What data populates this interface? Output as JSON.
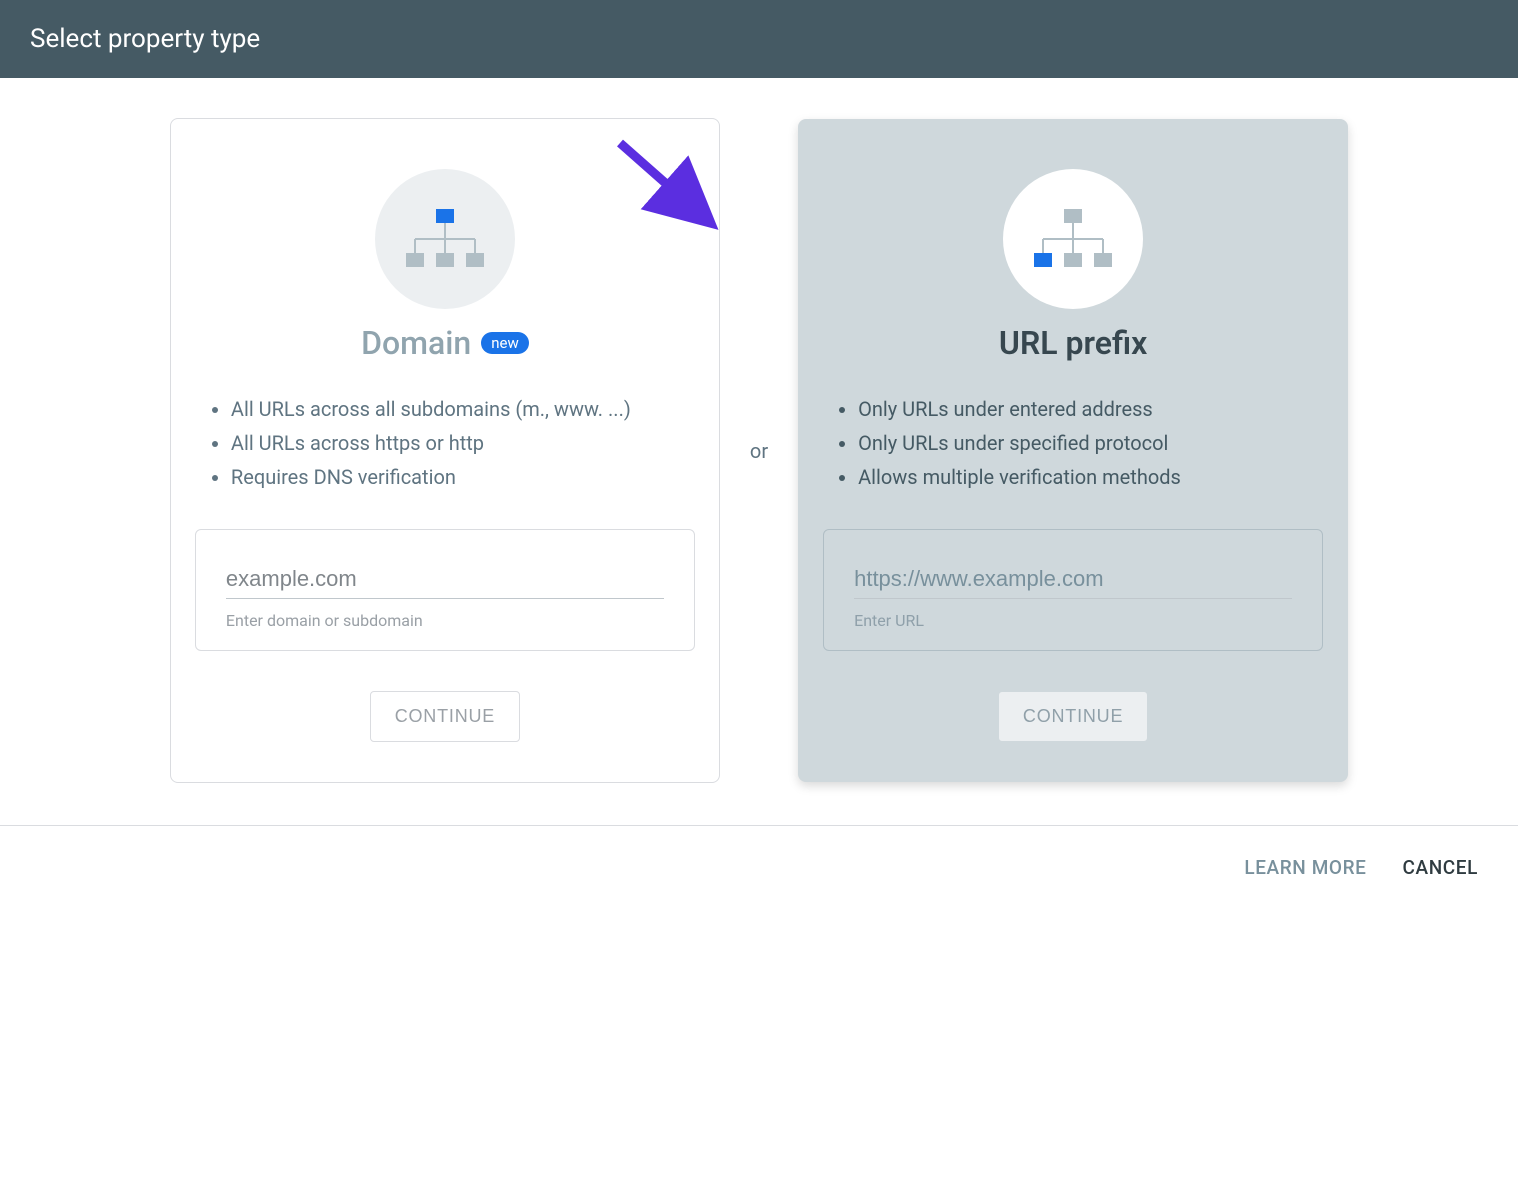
{
  "header": {
    "title": "Select property type"
  },
  "separator": "or",
  "domain_card": {
    "title": "Domain",
    "badge": "new",
    "features": [
      "All URLs across all subdomains (m., www. ...)",
      "All URLs across https or http",
      "Requires DNS verification"
    ],
    "input_placeholder": "example.com",
    "input_helper": "Enter domain or subdomain",
    "continue_label": "CONTINUE"
  },
  "urlprefix_card": {
    "title": "URL prefix",
    "features": [
      "Only URLs under entered address",
      "Only URLs under specified protocol",
      "Allows multiple verification methods"
    ],
    "input_placeholder": "https://www.example.com",
    "input_helper": "Enter URL",
    "continue_label": "CONTINUE"
  },
  "footer": {
    "learn_more": "LEARN MORE",
    "cancel": "CANCEL"
  }
}
